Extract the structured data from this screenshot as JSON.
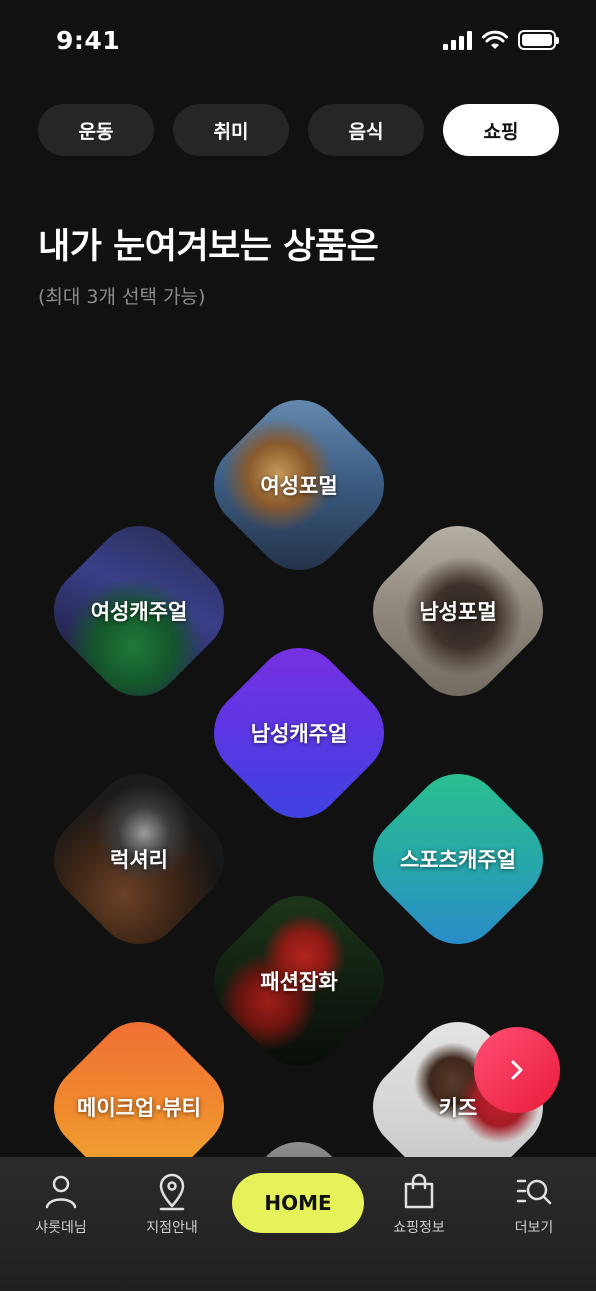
{
  "status": {
    "time": "9:41"
  },
  "tabs": [
    {
      "label": "운동",
      "active": false
    },
    {
      "label": "취미",
      "active": false
    },
    {
      "label": "음식",
      "active": false
    },
    {
      "label": "쇼핑",
      "active": true
    }
  ],
  "headline": "내가 눈여겨보는 상품은",
  "subline": "(최대 3개 선택 가능)",
  "categories": [
    {
      "label": "여성포멀",
      "icon": "photo-womens-formal"
    },
    {
      "label": "여성캐주얼",
      "icon": "photo-womens-casual"
    },
    {
      "label": "남성포멀",
      "icon": "photo-mens-formal"
    },
    {
      "label": "남성캐주얼",
      "color": "#6a34e0"
    },
    {
      "label": "럭셔리",
      "icon": "photo-luxury-watch"
    },
    {
      "label": "스포츠캐주얼",
      "color": "#25b39a"
    },
    {
      "label": "패션잡화",
      "icon": "photo-red-handbag"
    },
    {
      "label": "메이크업·뷰티",
      "color": "#f08a2e"
    },
    {
      "label": "키즈",
      "icon": "photo-kids"
    }
  ],
  "next_button": {
    "icon": "chevron-right-icon"
  },
  "nav": {
    "items": [
      {
        "label": "샤롯데님",
        "icon": "person-icon"
      },
      {
        "label": "지점안내",
        "icon": "location-pin-icon"
      },
      {
        "label": "HOME",
        "color": "#e6f25a"
      },
      {
        "label": "쇼핑정보",
        "icon": "shopping-bag-icon"
      },
      {
        "label": "더보기",
        "icon": "search-menu-icon"
      }
    ]
  }
}
